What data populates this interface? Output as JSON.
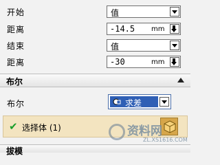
{
  "rows": [
    {
      "label": "开始",
      "value": "值"
    },
    {
      "label": "距离",
      "value": "-14.5",
      "unit": "mm"
    },
    {
      "label": "结束",
      "value": "值"
    },
    {
      "label": "距离",
      "value": "-30",
      "unit": "mm"
    }
  ],
  "boolean_section": {
    "title": "布尔",
    "bool_label": "布尔",
    "bool_value": "求差",
    "select_body": "选择体 (1)"
  },
  "next_section": {
    "title": "拔模"
  },
  "watermark": {
    "text": "资料网",
    "sub": "ZL.XS1616.COM"
  },
  "colors": {
    "selected": "#2f5fb5",
    "selection_bg": "#f3e4c0",
    "check": "#1a9e2a"
  }
}
